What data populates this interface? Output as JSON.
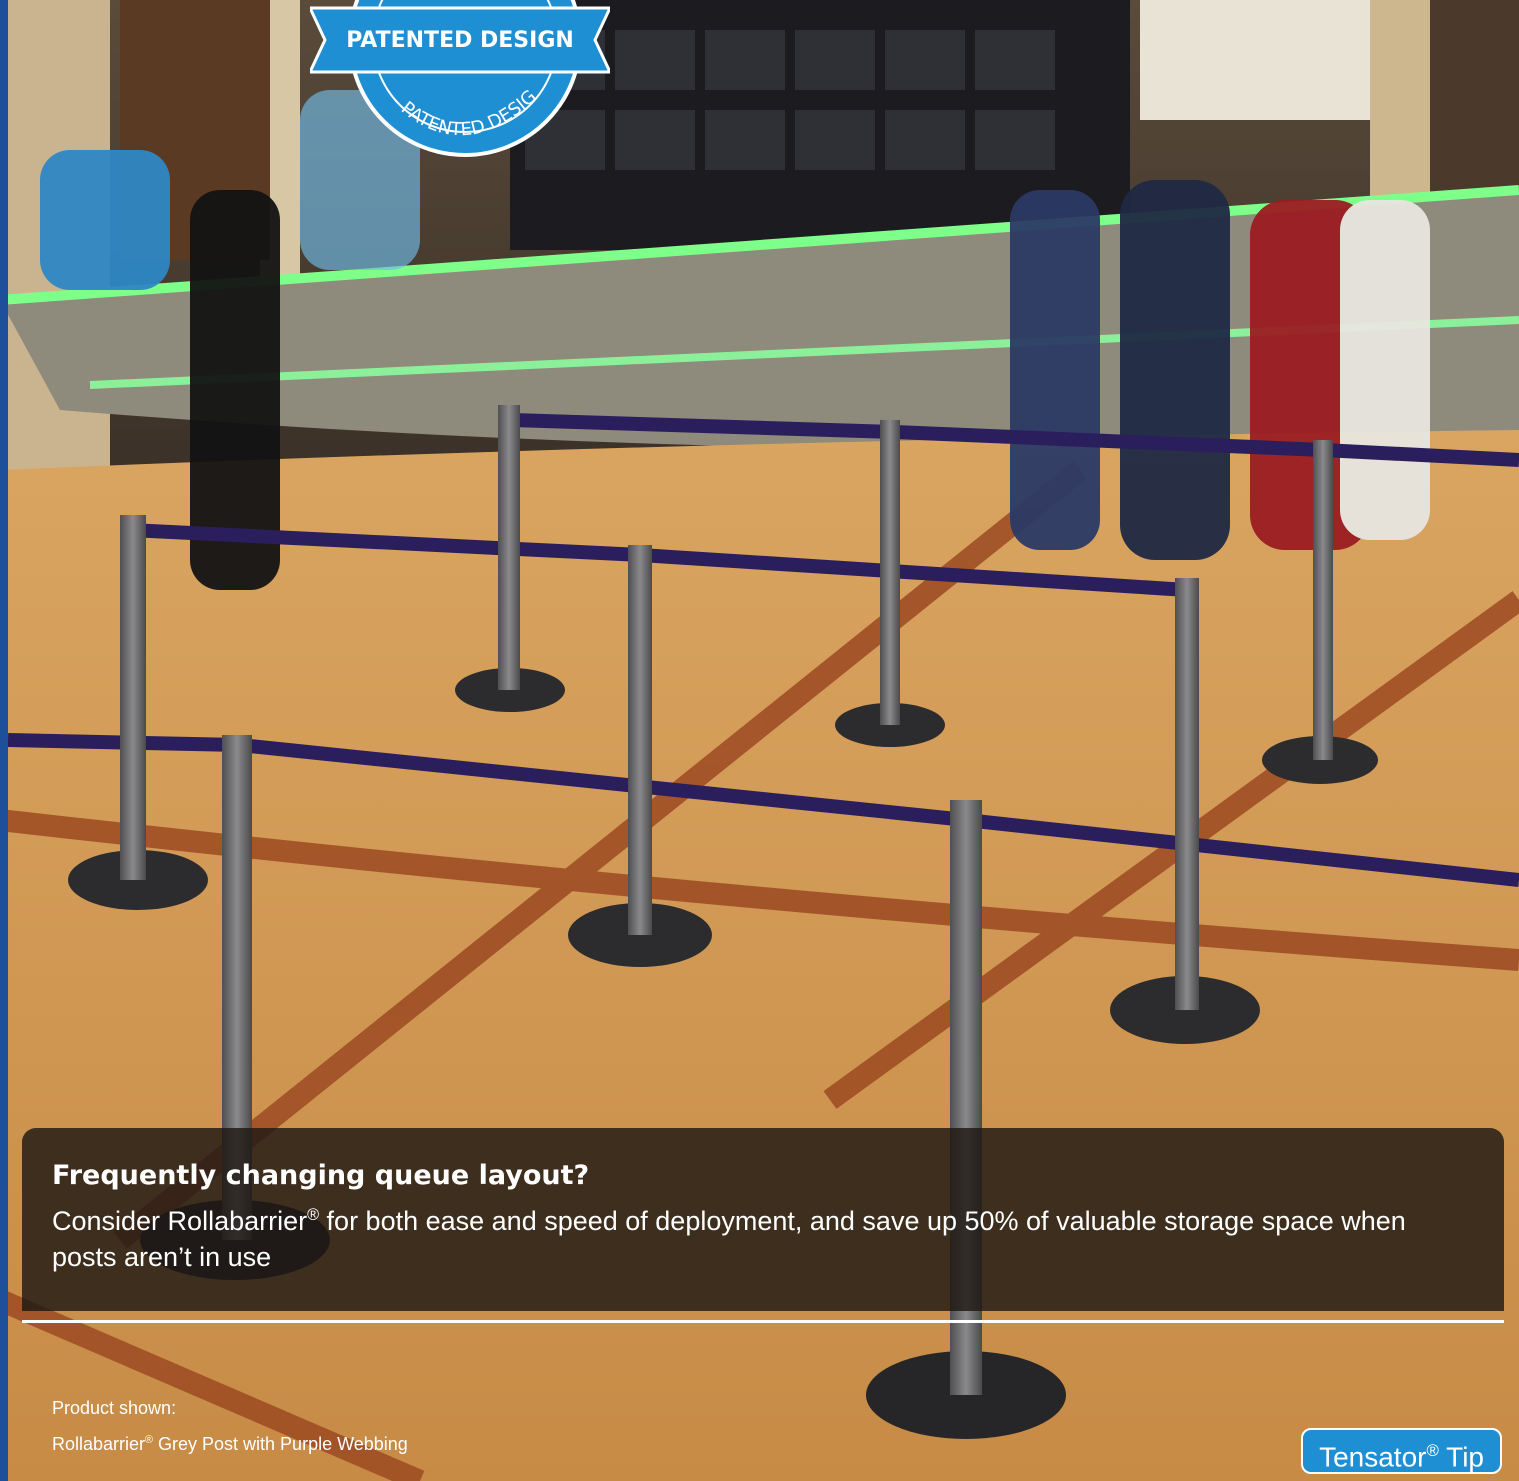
{
  "badge": {
    "label": "PATENTED DESIGN",
    "arc_text": "PATENTED DESIGN"
  },
  "tip": {
    "title": "Frequently changing queue layout?",
    "body_before": "Consider Rollabarrier",
    "body_sup": "®",
    "body_after": " for both ease and speed of deployment, and save up 50% of valuable storage space when posts aren’t in use"
  },
  "caption": {
    "line1": "Product shown:",
    "line2_before": "Rollabarrier",
    "line2_sup": "®",
    "line2_after": " Grey Post with Purple Webbing"
  },
  "tensator_tip": {
    "before": "Tensator",
    "sup": "®",
    "after": " Tip"
  },
  "colors": {
    "brand_blue": "#1f8fd4",
    "webbing_purple": "#2a1f5c",
    "overlay": "#1e1814"
  }
}
